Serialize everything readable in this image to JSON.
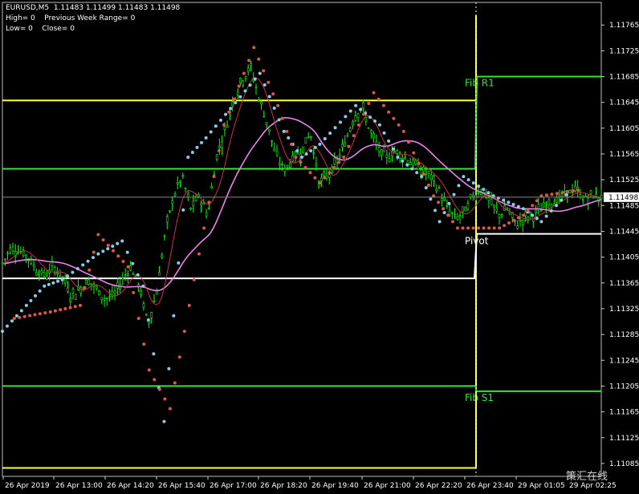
{
  "header": {
    "symbol_line": "EURUSD,M5  1.11483 1.11499 1.11483 1.11498",
    "line2": "High= 0    Previous Week Range= 0",
    "line3": "Low= 0    Close= 0"
  },
  "watermark": "策汇在线",
  "colors": {
    "background": "#000000",
    "candles": "#00ff00",
    "yellow_level": "#ffff33",
    "green_level": "#33e633",
    "white_level": "#ffffff",
    "sar_blue": "#87ceeb",
    "sar_red": "#e0554a",
    "ma_pink": "#ee82ee",
    "ma_red": "#cc3333",
    "price_label_bg": "#ffffff"
  },
  "chart_data": {
    "type": "candlestick",
    "symbol": "EURUSD",
    "timeframe": "M5",
    "current_price": 1.11498,
    "ylim": [
      1.11065,
      1.118
    ],
    "y_ticks": [
      1.11765,
      1.11725,
      1.11685,
      1.11645,
      1.11605,
      1.11565,
      1.11525,
      1.11485,
      1.11445,
      1.11405,
      1.11365,
      1.11325,
      1.11285,
      1.11245,
      1.11205,
      1.11165,
      1.11125,
      1.11085
    ],
    "y_tick_labels": [
      "1.11765",
      "1.11725",
      "1.11685",
      "1.11645",
      "1.11605",
      "1.11565",
      "1.11525",
      "1.11485",
      "1.11445",
      "1.11405",
      "1.11365",
      "1.11325",
      "1.11285",
      "1.11245",
      "1.11205",
      "1.11165",
      "1.11125",
      "1.11085"
    ],
    "x_tick_labels": [
      "26 Apr 2019",
      "26 Apr 13:00",
      "26 Apr 14:20",
      "26 Apr 15:40",
      "26 Apr 17:00",
      "26 Apr 18:20",
      "26 Apr 19:40",
      "26 Apr 21:00",
      "26 Apr 22:20",
      "26 Apr 23:40",
      "29 Apr 01:05",
      "29 Apr 02:25"
    ],
    "separator_label": "26 Apr 23:40",
    "levels_before": [
      {
        "name": "previous-high",
        "price": 1.11648,
        "color": "yellow"
      },
      {
        "name": "green-upper",
        "price": 1.11542,
        "color": "green"
      },
      {
        "name": "white-lower",
        "price": 1.11372,
        "color": "white"
      },
      {
        "name": "green-lower",
        "price": 1.11205,
        "color": "green"
      },
      {
        "name": "previous-low",
        "price": 1.11078,
        "color": "yellow"
      }
    ],
    "levels_after": [
      {
        "name": "Fib R1",
        "label": "Fib R1",
        "price": 1.11685,
        "color": "green"
      },
      {
        "name": "Pivot",
        "label": "Pivot",
        "price": 1.11441,
        "color": "white"
      },
      {
        "name": "Fib S1",
        "label": "Fib S1",
        "price": 1.11197,
        "color": "green"
      }
    ],
    "close_path": [
      1.11395,
      1.1142,
      1.11415,
      1.11405,
      1.11385,
      1.11375,
      1.1139,
      1.11375,
      1.11345,
      1.11355,
      1.1137,
      1.11355,
      1.1134,
      1.11345,
      1.1137,
      1.1139,
      1.1136,
      1.113,
      1.1135,
      1.1144,
      1.115,
      1.1153,
      1.1148,
      1.115,
      1.1147,
      1.1156,
      1.116,
      1.1165,
      1.1168,
      1.117,
      1.1165,
      1.1161,
      1.1156,
      1.1154,
      1.1156,
      1.1157,
      1.116,
      1.1152,
      1.1153,
      1.1155,
      1.1158,
      1.1162,
      1.1164,
      1.116,
      1.1157,
      1.1156,
      1.1157,
      1.1156,
      1.1155,
      1.1154,
      1.1153,
      1.1151,
      1.1148,
      1.11465,
      1.11475,
      1.115,
      1.1151,
      1.1149,
      1.1147,
      1.1148,
      1.11455,
      1.11465,
      1.1147,
      1.1148,
      1.1149,
      1.11495,
      1.11505,
      1.1151,
      1.11495,
      1.115,
      1.11498
    ],
    "sar_blue": [
      [
        0.0,
        1.1129
      ],
      [
        0.04,
        1.1133
      ],
      [
        0.07,
        1.1136
      ],
      [
        0.1,
        1.1137
      ],
      [
        0.16,
        1.1141
      ],
      [
        0.2,
        1.1143
      ],
      [
        0.235,
        1.1136
      ],
      [
        0.27,
        1.1115
      ],
      [
        0.31,
        1.1156
      ],
      [
        0.34,
        1.1159
      ],
      [
        0.43,
        1.1169
      ],
      [
        0.47,
        1.116
      ],
      [
        0.5,
        1.1156
      ],
      [
        0.53,
        1.1158
      ],
      [
        0.59,
        1.1164
      ],
      [
        0.63,
        1.1161
      ],
      [
        0.66,
        1.1156
      ],
      [
        0.7,
        1.1153
      ],
      [
        0.73,
        1.1146
      ],
      [
        0.77,
        1.1153
      ],
      [
        0.82,
        1.115
      ],
      [
        0.87,
        1.1148
      ],
      [
        0.9,
        1.1146
      ],
      [
        0.95,
        1.1151
      ]
    ],
    "sar_red": [
      [
        0.02,
        1.1131
      ],
      [
        0.08,
        1.1132
      ],
      [
        0.13,
        1.1133
      ],
      [
        0.16,
        1.1144
      ],
      [
        0.21,
        1.1139
      ],
      [
        0.245,
        1.1123
      ],
      [
        0.28,
        1.1117
      ],
      [
        0.32,
        1.1137
      ],
      [
        0.37,
        1.1161
      ],
      [
        0.42,
        1.1173
      ],
      [
        0.46,
        1.1164
      ],
      [
        0.49,
        1.1156
      ],
      [
        0.53,
        1.1152
      ],
      [
        0.57,
        1.1156
      ],
      [
        0.62,
        1.1166
      ],
      [
        0.67,
        1.116
      ],
      [
        0.72,
        1.115
      ],
      [
        0.76,
        1.1145
      ],
      [
        0.83,
        1.1145
      ],
      [
        0.87,
        1.1147
      ],
      [
        0.9,
        1.115
      ],
      [
        0.97,
        1.1151
      ]
    ]
  }
}
